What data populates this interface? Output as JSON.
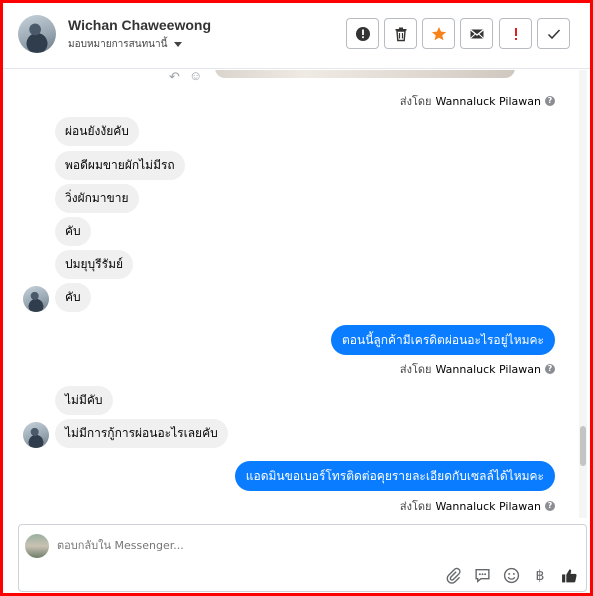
{
  "header": {
    "name": "Wichan Chaweewong",
    "subtitle": "มอบหมายการสนทนานี้",
    "actions": [
      "alert-circle-icon",
      "trash-icon",
      "star-icon",
      "mail-icon",
      "exclamation-icon",
      "check-icon"
    ],
    "star_color": "#f7821b",
    "exclamation_color": "#e02020"
  },
  "thread": {
    "sent_by_label": "ส่งโดย",
    "sender_name": "Wannaluck Pilawan",
    "incoming_group_1": [
      "ผ่อนยังงัยคับ",
      "พอดีผมขายผักไม่มีรถ",
      "วิ่งผักมาขาย",
      "คับ",
      "ปมยุบุรีรัมย์",
      "คับ"
    ],
    "outgoing_1": "ตอนนี้ลูกค้ามีเครดิตผ่อนอะไรอยู่ไหมคะ",
    "incoming_group_2": [
      "ไม่มีคับ",
      "ไม่มีการกู้การผ่อนอะไรเลยคับ"
    ],
    "outgoing_2": "แอดมินขอเบอร์โทรติดต่อคุยรายละเอียดกับเซลล์ได้ไหมคะ",
    "outgoing_color": "#0a7cff"
  },
  "composer": {
    "placeholder": "ตอบกลับใน Messenger...",
    "icons": [
      "paperclip-icon",
      "chat-icon",
      "emoji-icon",
      "baht-icon",
      "like-icon"
    ],
    "baht_symbol": "฿"
  }
}
